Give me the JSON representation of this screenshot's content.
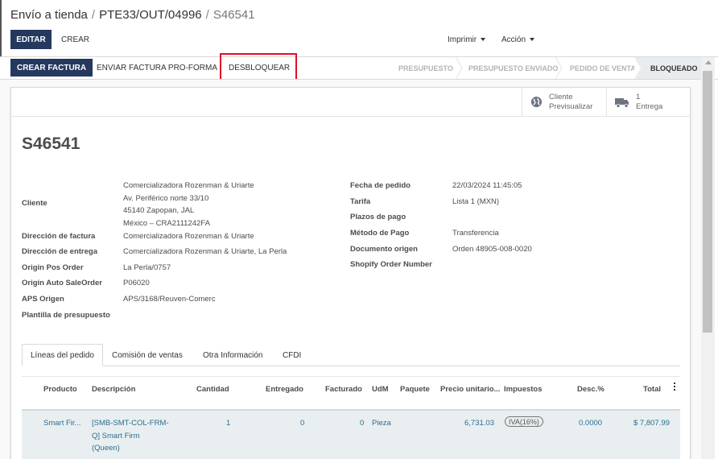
{
  "breadcrumb": {
    "items": [
      "Envío a tienda",
      "PTE33/OUT/04996"
    ],
    "current": "S46541",
    "separator": "/"
  },
  "toolbar": {
    "edit_label": "EDITAR",
    "create_label": "CREAR",
    "print_label": "Imprimir",
    "action_label": "Acción"
  },
  "statusbar": {
    "create_invoice_label": "CREAR FACTURA",
    "proforma_label": "ENVIAR FACTURA PRO-FORMA",
    "unlock_label": "DESBLOQUEAR",
    "stages": [
      "PRESUPUESTO",
      "PRESUPUESTO ENVIADO",
      "PEDIDO DE VENTA",
      "BLOQUEADO"
    ],
    "current_stage": "BLOQUEADO"
  },
  "smart_buttons": {
    "preview": {
      "line1": "Cliente",
      "line2": "Previsualizar",
      "icon": "globe-icon"
    },
    "delivery": {
      "line1": "1",
      "line2": "Entrega",
      "icon": "truck-icon"
    }
  },
  "order": {
    "name": "S46541",
    "left": {
      "customer_label": "Cliente",
      "customer_lines": [
        "Comercializadora Rozenman & Uriarte",
        "Av. Periférico norte 33/10",
        "45140 Zapopan, JAL",
        "México – CRA2111242FA"
      ],
      "invoice_address_label": "Dirección de factura",
      "invoice_address": "Comercializadora Rozenman & Uriarte",
      "delivery_address_label": "Dirección de entrega",
      "delivery_address": "Comercializadora Rozenman & Uriarte, La Perla",
      "pos_order_label": "Origin Pos Order",
      "pos_order": "La Perla/0757",
      "auto_saleorder_label": "Origin Auto SaleOrder",
      "auto_saleorder": "P06020",
      "aps_label": "APS Origen",
      "aps": "APS/3168/Reuven-Comerc",
      "template_label": "Plantilla de presupuesto"
    },
    "right": {
      "order_date_label": "Fecha de pedido",
      "order_date": "22/03/2024 11:45:05",
      "pricelist_label": "Tarifa",
      "pricelist": "Lista 1 (MXN)",
      "payment_terms_label": "Plazos de pago",
      "payment_method_label": "Método de Pago",
      "payment_method": "Transferencia",
      "source_doc_label": "Documento origen",
      "source_doc": "Orden 48905-008-0020",
      "shopify_label": "Shopify Order Number"
    }
  },
  "tabs": [
    "Líneas del pedido",
    "Comisión de ventas",
    "Otra Información",
    "CFDI"
  ],
  "lines": {
    "headers": [
      "Producto",
      "Descripción",
      "Cantidad",
      "Entregado",
      "Facturado",
      "UdM",
      "Paquete",
      "Precio unitario...",
      "Impuestos",
      "Desc.%",
      "Total"
    ],
    "rows": [
      {
        "product": "Smart Fir...",
        "description": [
          "[SMB-SMT-COL-FRM-",
          "Q] Smart Firm",
          "(Queen)"
        ],
        "qty": "1",
        "delivered": "0",
        "invoiced": "0",
        "uom": "Pieza",
        "package": "",
        "price": "6,731.03",
        "tax": "IVA(16%)",
        "discount": "0.0000",
        "total": "$ 7,807.99"
      }
    ]
  },
  "colors": {
    "primary": "#25385e",
    "highlight": "#e0102a",
    "link": "#2a6f91"
  }
}
